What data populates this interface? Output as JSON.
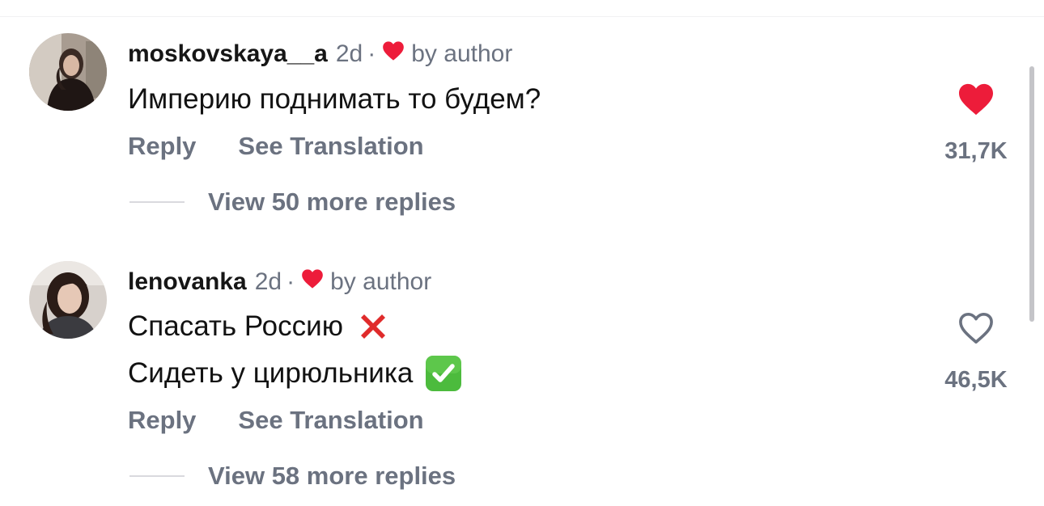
{
  "colors": {
    "accent_red": "#ed1c3a",
    "muted_text": "#6b7280",
    "primary_text": "#121212",
    "rule": "#d9d9de",
    "scrollbar": "#c4c4c8"
  },
  "comments": [
    {
      "username": "moskovskaya__a",
      "age": "2d",
      "separator": "·",
      "liked_by_author_icon": "heart-icon",
      "by_author": "by author",
      "text_lines": [
        "Империю поднимать то будем?"
      ],
      "reply_label": "Reply",
      "translation_label": "See Translation",
      "view_replies_label": "View 50 more replies",
      "like_count": "31,7K",
      "liked": true,
      "like_icon": "heart-filled-icon"
    },
    {
      "username": "lenovanka",
      "age": "2d",
      "separator": "·",
      "liked_by_author_icon": "heart-icon",
      "by_author": "by author",
      "text_lines": [
        "Спасать Россию",
        "Сидеть у цирюльника"
      ],
      "line_emojis": [
        "cross-mark-icon",
        "check-mark-button-icon"
      ],
      "reply_label": "Reply",
      "translation_label": "See Translation",
      "view_replies_label": "View 58 more replies",
      "like_count": "46,5K",
      "liked": false,
      "like_icon": "heart-outline-icon"
    }
  ]
}
